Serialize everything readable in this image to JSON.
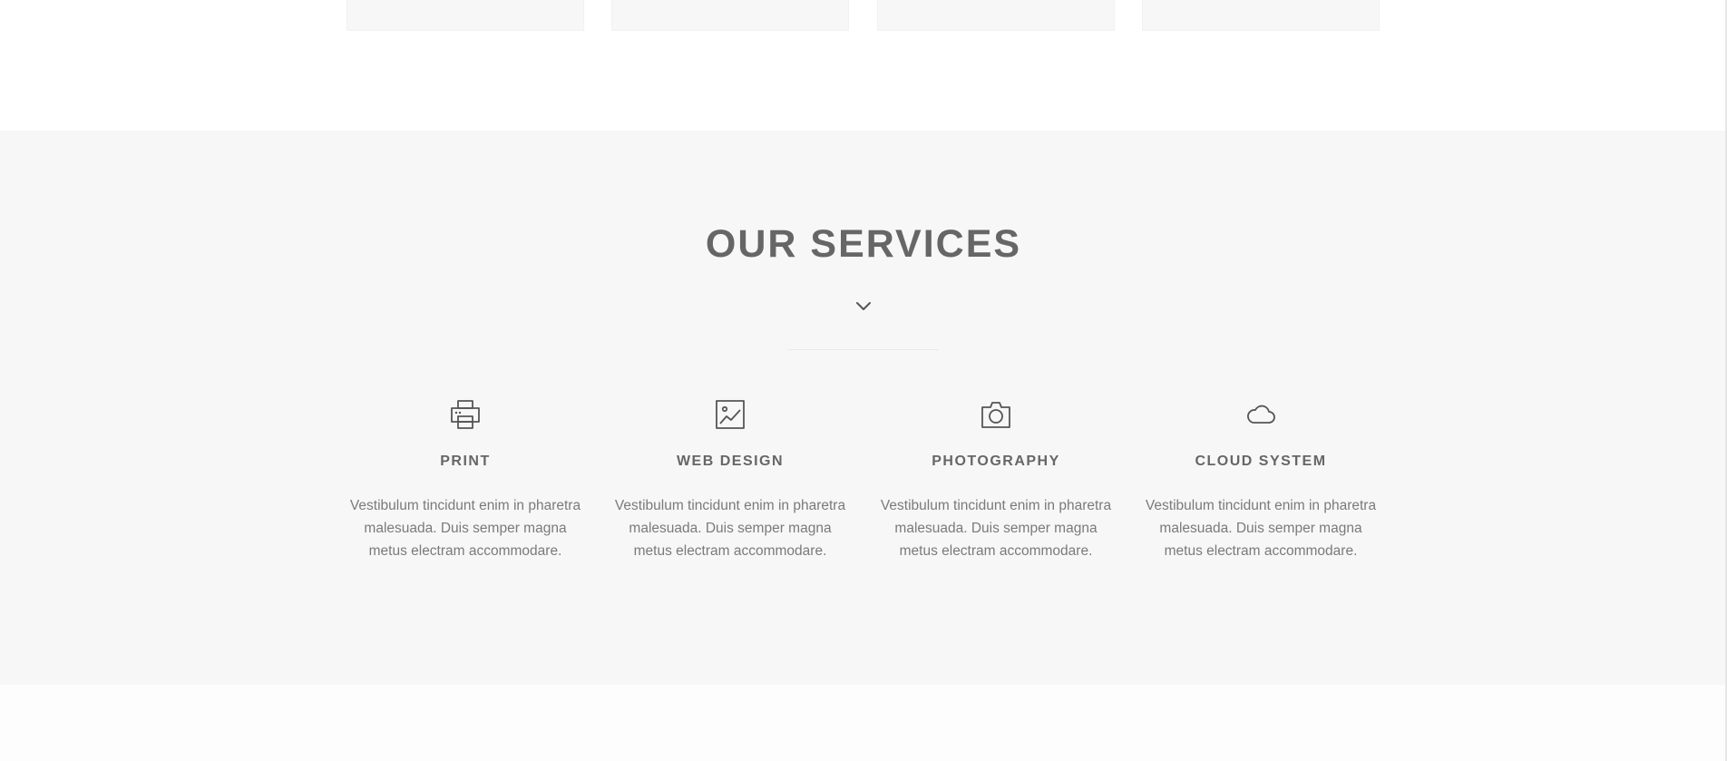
{
  "services_section": {
    "title": "OUR SERVICES",
    "chevron_icon": "chevron-down-icon",
    "items": [
      {
        "icon": "printer-icon",
        "title": "PRINT",
        "text": "Vestibulum tincidunt enim in pharetra malesuada. Duis semper magna metus electram accommodare."
      },
      {
        "icon": "image-icon",
        "title": "WEB DESIGN",
        "text": "Vestibulum tincidunt enim in pharetra malesuada. Duis semper magna metus electram accommodare."
      },
      {
        "icon": "camera-icon",
        "title": "PHOTOGRAPHY",
        "text": "Vestibulum tincidunt enim in pharetra malesuada. Duis semper magna metus electram accommodare."
      },
      {
        "icon": "cloud-icon",
        "title": "CLOUD SYSTEM",
        "text": "Vestibulum tincidunt enim in pharetra malesuada. Duis semper magna metus electram accommodare."
      }
    ]
  },
  "colors": {
    "section_background": "#f7f7f7",
    "page_background": "#ffffff",
    "heading": "#666666",
    "body_text": "#7a7a7a",
    "icon_stroke": "#555555"
  }
}
